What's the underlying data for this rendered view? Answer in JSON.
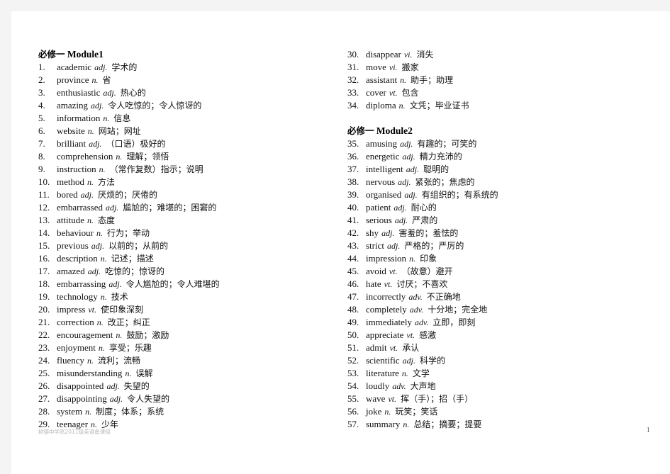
{
  "document": {
    "footer_note": "树德中学高2011级英语备课组",
    "page_number": "1"
  },
  "columns": [
    {
      "blocks": [
        {
          "type": "heading",
          "cn": "必修一",
          "en": "Module1"
        },
        {
          "type": "list",
          "items": [
            {
              "num": "1.",
              "word": "academic",
              "pos": "adj.",
              "cn": "学术的"
            },
            {
              "num": "2.",
              "word": "province",
              "pos": "n.",
              "cn": "省"
            },
            {
              "num": "3.",
              "word": "enthusiastic",
              "pos": "adj.",
              "cn": "热心的"
            },
            {
              "num": "4.",
              "word": "amazing",
              "pos": "adj.",
              "cn": "令人吃惊的；令人惊讶的"
            },
            {
              "num": "5.",
              "word": "information",
              "pos": "n.",
              "cn": "信息"
            },
            {
              "num": "6.",
              "word": "website",
              "pos": "n.",
              "cn": "网站；网址"
            },
            {
              "num": "7.",
              "word": "brilliant",
              "pos": "adj.",
              "cn": "（口语）极好的"
            },
            {
              "num": "8.",
              "word": "comprehension",
              "pos": "n.",
              "cn": "理解；领悟"
            },
            {
              "num": "9.",
              "word": "instruction",
              "pos": "n.",
              "cn": "（常作复数）指示；说明"
            },
            {
              "num": "10.",
              "word": "method",
              "pos": "n.",
              "cn": "方法"
            },
            {
              "num": "11.",
              "word": "bored",
              "pos": "adj.",
              "cn": "厌烦的；厌倦的"
            },
            {
              "num": "12.",
              "word": "embarrassed",
              "pos": "adj.",
              "cn": "尴尬的；难堪的；困窘的"
            },
            {
              "num": "13.",
              "word": "attitude",
              "pos": "n.",
              "cn": "态度"
            },
            {
              "num": "14.",
              "word": "behaviour",
              "pos": "n.",
              "cn": "行为；举动"
            },
            {
              "num": "15.",
              "word": "previous",
              "pos": "adj.",
              "cn": "以前的；从前的"
            },
            {
              "num": "16.",
              "word": "description",
              "pos": "n.",
              "cn": "记述；描述"
            },
            {
              "num": "17.",
              "word": "amazed",
              "pos": "adj.",
              "cn": "吃惊的；惊讶的"
            },
            {
              "num": "18.",
              "word": "embarrassing",
              "pos": "adj.",
              "cn": "令人尴尬的；令人难堪的"
            },
            {
              "num": "19.",
              "word": "technology",
              "pos": "n.",
              "cn": "技术"
            },
            {
              "num": "20.",
              "word": "impress",
              "pos": "vt.",
              "cn": "使印象深刻"
            },
            {
              "num": "21.",
              "word": "correction",
              "pos": "n.",
              "cn": "改正；纠正"
            },
            {
              "num": "22.",
              "word": "encouragement",
              "pos": "n.",
              "cn": "鼓励；激励"
            },
            {
              "num": "23.",
              "word": "enjoyment",
              "pos": "n.",
              "cn": "享受；乐趣"
            },
            {
              "num": "24.",
              "word": "fluency",
              "pos": "n.",
              "cn": "流利；流畅"
            },
            {
              "num": "25.",
              "word": "misunderstanding",
              "pos": "n.",
              "cn": "误解"
            },
            {
              "num": "26.",
              "word": "disappointed",
              "pos": "adj.",
              "cn": "失望的"
            },
            {
              "num": "27.",
              "word": "disappointing",
              "pos": "adj.",
              "cn": "令人失望的"
            },
            {
              "num": "28.",
              "word": "system",
              "pos": "n.",
              "cn": "制度；体系；系统"
            },
            {
              "num": "29.",
              "word": "teenager",
              "pos": "n.",
              "cn": "少年"
            }
          ]
        }
      ]
    },
    {
      "blocks": [
        {
          "type": "list",
          "items": [
            {
              "num": "30.",
              "word": "disappear",
              "pos": "vi.",
              "cn": "消失"
            },
            {
              "num": "31.",
              "word": "move",
              "pos": "vi.",
              "cn": "搬家"
            },
            {
              "num": "32.",
              "word": "assistant",
              "pos": "n.",
              "cn": "助手；助理"
            },
            {
              "num": "33.",
              "word": "cover",
              "pos": "vt.",
              "cn": "包含"
            },
            {
              "num": "34.",
              "word": "diploma",
              "pos": "n.",
              "cn": "文凭；毕业证书"
            }
          ]
        },
        {
          "type": "spacer"
        },
        {
          "type": "heading",
          "cn": "必修一",
          "en": "Module2"
        },
        {
          "type": "list",
          "items": [
            {
              "num": "35.",
              "word": "amusing",
              "pos": "adj.",
              "cn": "有趣的；可笑的"
            },
            {
              "num": "36.",
              "word": "energetic",
              "pos": "adj.",
              "cn": "精力充沛的"
            },
            {
              "num": "37.",
              "word": "intelligent",
              "pos": "adj.",
              "cn": "聪明的"
            },
            {
              "num": "38.",
              "word": "nervous",
              "pos": "adj.",
              "cn": "紧张的；焦虑的"
            },
            {
              "num": "39.",
              "word": "organised",
              "pos": "adj.",
              "cn": "有组织的；有系统的"
            },
            {
              "num": "40.",
              "word": "patient",
              "pos": "adj.",
              "cn": "耐心的"
            },
            {
              "num": "41.",
              "word": "serious",
              "pos": "adj.",
              "cn": "严肃的"
            },
            {
              "num": "42.",
              "word": "shy",
              "pos": "adj.",
              "cn": "害羞的；羞怯的"
            },
            {
              "num": "43.",
              "word": "strict",
              "pos": "adj.",
              "cn": "严格的；严厉的"
            },
            {
              "num": "44.",
              "word": "impression",
              "pos": "n.",
              "cn": "印象"
            },
            {
              "num": "45.",
              "word": "avoid",
              "pos": "vt.",
              "cn": "（故意）避开"
            },
            {
              "num": "46.",
              "word": "hate",
              "pos": "vt.",
              "cn": "讨厌；不喜欢"
            },
            {
              "num": "47.",
              "word": "incorrectly",
              "pos": "adv.",
              "cn": "不正确地"
            },
            {
              "num": "48.",
              "word": "completely",
              "pos": "adv.",
              "cn": "十分地；完全地"
            },
            {
              "num": "49.",
              "word": "immediately",
              "pos": "adv.",
              "cn": "立即，即刻"
            },
            {
              "num": "50.",
              "word": "appreciate",
              "pos": "vt.",
              "cn": "感激"
            },
            {
              "num": "51.",
              "word": "admit",
              "pos": "vt.",
              "cn": "承认"
            },
            {
              "num": "52.",
              "word": "scientific",
              "pos": "adj.",
              "cn": "科学的"
            },
            {
              "num": "53.",
              "word": "literature",
              "pos": "n.",
              "cn": "文学"
            },
            {
              "num": "54.",
              "word": "loudly",
              "pos": "adv.",
              "cn": "大声地"
            },
            {
              "num": "55.",
              "word": "wave",
              "pos": "vt.",
              "cn": "挥（手）；招（手）"
            },
            {
              "num": "56.",
              "word": "joke",
              "pos": "n.",
              "cn": "玩笑；笑话"
            },
            {
              "num": "57.",
              "word": "summary",
              "pos": "n.",
              "cn": "总结；摘要；提要"
            }
          ]
        }
      ]
    }
  ]
}
